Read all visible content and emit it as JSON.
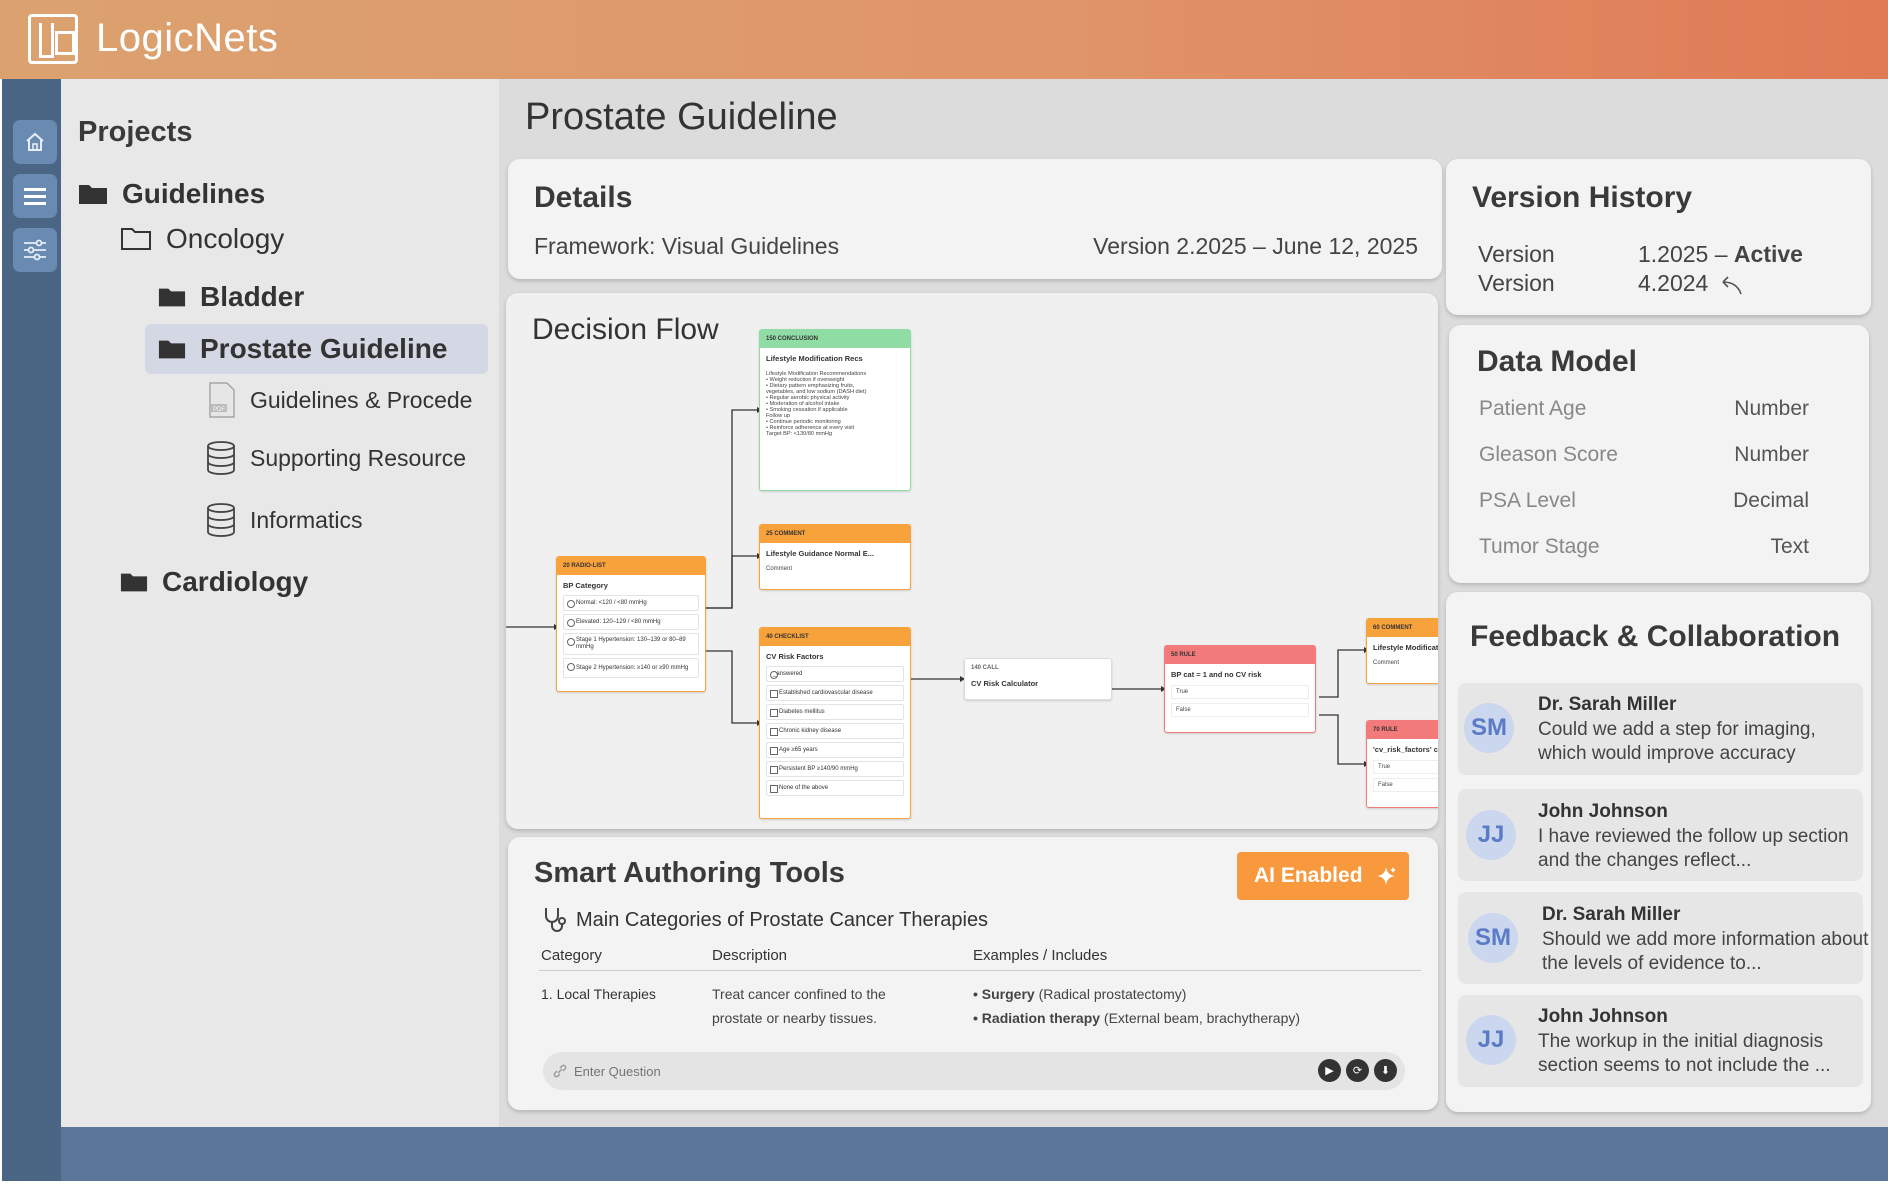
{
  "app": {
    "brand": "LogicNets"
  },
  "rail": {
    "items": [
      "home-icon",
      "menu-icon",
      "filter-sliders-icon"
    ]
  },
  "sidebar": {
    "heading": "Projects",
    "tree": {
      "guidelines": "Guidelines",
      "oncology": "Oncology",
      "bladder": "Bladder",
      "prostate": "Prostate Guideline",
      "docs": [
        "Guidelines & Procede",
        "Supporting Resource",
        "Informatics"
      ],
      "cardiology": "Cardiology"
    }
  },
  "page": {
    "title": "Prostate Guideline"
  },
  "details": {
    "title": "Details",
    "framework": "Framework: Visual Guidelines",
    "version": "Version  2.2025 – June 12, 2025"
  },
  "version_history": {
    "title": "Version History",
    "rows": [
      {
        "label": "Version",
        "value": "1.2025 –",
        "status": "Active"
      },
      {
        "label": "Version",
        "value": "4.2024",
        "status": ""
      }
    ]
  },
  "data_model": {
    "title": "Data Model",
    "rows": [
      {
        "field": "Patient Age",
        "type": "Number"
      },
      {
        "field": "Gleason Score",
        "type": "Number"
      },
      {
        "field": "PSA Level",
        "type": "Decimal"
      },
      {
        "field": "Tumor Stage",
        "type": "Text"
      }
    ]
  },
  "flow": {
    "title": "Decision Flow",
    "radio": {
      "header": "20 RADIO-LIST",
      "title": "BP Category",
      "options": [
        "Normal: <120 / <80 mmHg",
        "Elevated: 120–129 / <80 mmHg",
        "Stage 1 Hypertension: 130–139 or 80–89 mmHg",
        "Stage 2 Hypertension: ≥140 or ≥90 mmHg"
      ]
    },
    "conclusion": {
      "header": "150 CONCLUSION",
      "title": "Lifestyle Modification Recs",
      "lines": [
        "Lifestyle Modification Recommendations",
        "•  Weight reduction if overweight",
        "•  Dietary pattern emphasizing fruits,",
        "    vegetables, and low sodium (DASH diet)",
        "•  Regular aerobic physical activity",
        "•  Moderation of alcohol intake",
        "•  Smoking cessation if applicable",
        "Follow up",
        "•  Continue periodic monitoring",
        "•  Reinforce adherence at every visit",
        "Target BP: <130/80 mmHg"
      ]
    },
    "comment1": {
      "header": "25 COMMENT",
      "title": "Lifestyle Guidance Normal E...",
      "body": "Comment"
    },
    "checklist": {
      "header": "40 CHECKLIST",
      "title": "CV Risk Factors",
      "answered": "_answered",
      "options": [
        "Established cardiovascular disease",
        "Diabetes mellitus",
        "Chronic kidney disease",
        "Age ≥65 years",
        "Persistent BP ≥140/90 mmHg",
        "None of the above"
      ]
    },
    "call": {
      "header": "140 CALL",
      "title": "CV Risk Calculator"
    },
    "rule1": {
      "header": "50 RULE",
      "title": "BP cat = 1 and no CV risk",
      "opts": [
        "True",
        "False"
      ]
    },
    "comment2": {
      "header": "60 COMMENT",
      "title": "Lifestyle Modificat",
      "body": "Comment"
    },
    "rule2": {
      "header": "70 RULE",
      "title": "'cv_risk_factors' c",
      "opts": [
        "True",
        "False"
      ]
    }
  },
  "smart": {
    "title": "Smart Authoring Tools",
    "ai_label": "AI Enabled",
    "subtitle": "Main Categories of Prostate Cancer Therapies",
    "headers": [
      "Category",
      "Description",
      "Examples / Includes"
    ],
    "row": {
      "category": "1. Local Therapies",
      "desc1": "Treat cancer confined to the",
      "desc2": "prostate or nearby tissues.",
      "ex1b": "• Surgery",
      "ex1": " (Radical prostatectomy)",
      "ex2b": "• Radiation therapy",
      "ex2": " (External beam, brachytherapy)"
    },
    "placeholder": "Enter Question"
  },
  "feedback": {
    "title": "Feedback & Collaboration",
    "items": [
      {
        "initials": "SM",
        "name": "Dr. Sarah Miller",
        "msg": "Could we add a step for imaging, which would improve accuracy"
      },
      {
        "initials": "JJ",
        "name": "John Johnson",
        "msg": "I have reviewed the follow up section and the changes reflect..."
      },
      {
        "initials": "SM",
        "name": "Dr. Sarah Miller",
        "msg": "Should we add more information about the levels of evidence to..."
      },
      {
        "initials": "JJ",
        "name": "John Johnson",
        "msg": "The workup in the initial diagnosis section seems to not include the ..."
      }
    ]
  },
  "colors": {
    "accent": "#f7993c",
    "rail": "#4b6585",
    "selected": "#d4d8e4",
    "avatar": "#cbd6ef"
  }
}
